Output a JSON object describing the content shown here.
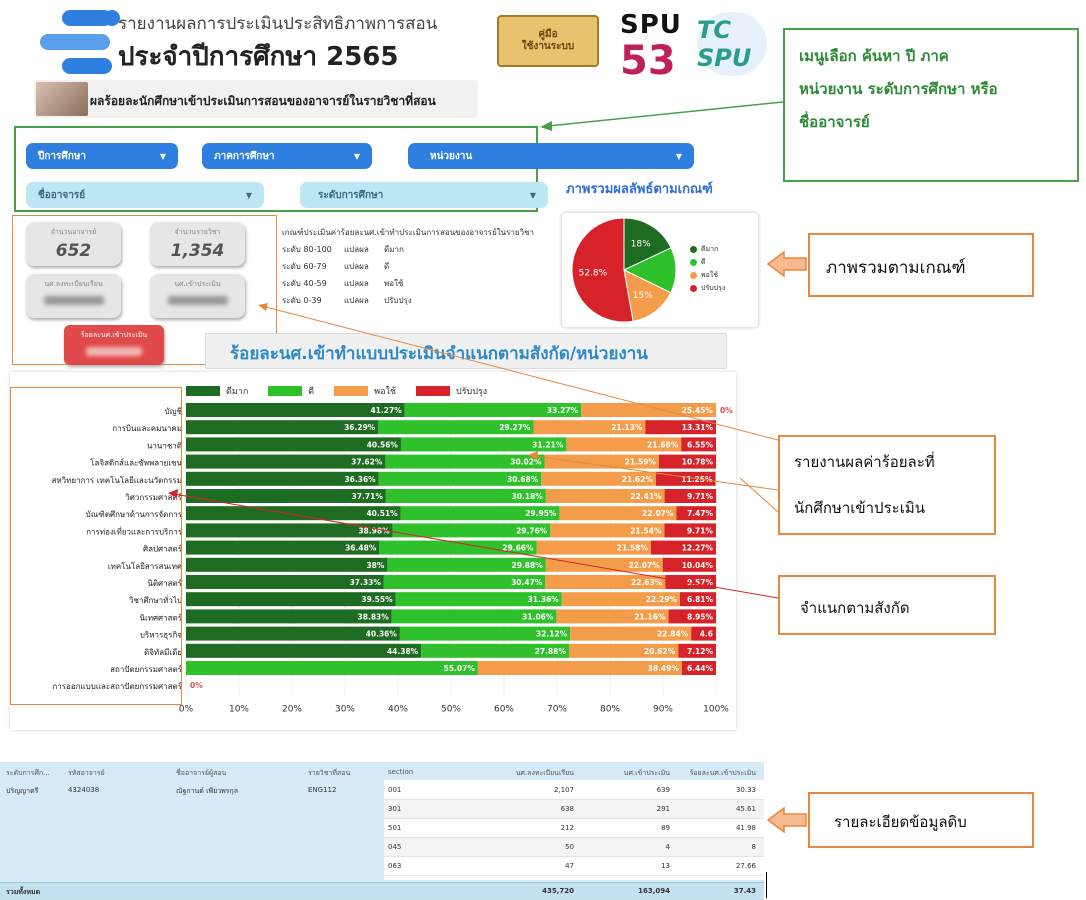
{
  "header": {
    "title_line1": "รายงานผลการประเมินประสิทธิภาพการสอน",
    "title_line2": "ประจำปีการศึกษา 2565",
    "subtitle": "ผลร้อยละนักศึกษาเข้าประเมินการสอนของอาจารย์ในรายวิชาที่สอน",
    "manual_label": "คู่มือ\nใช้งานระบบ",
    "logo_spu": "SPU",
    "logo_53": "53",
    "logo_tcspu": "TC SPU"
  },
  "filters": {
    "year": "ปีการศึกษา",
    "semester": "ภาคการศึกษา",
    "unit": "หน่วยงาน",
    "teacher": "ชื่ออาจารย์",
    "level": "ระดับการศึกษา"
  },
  "annotations": {
    "menu_line1": "เมนูเลือก ค้นหา ปี ภาค",
    "menu_line2": "หน่วยงาน ระดับการศึกษา หรือ",
    "menu_line3": "ชื่ออาจารย์",
    "pie_overview": "ภาพรวมตามเกณฑ์",
    "percent_line1": "รายงานผลค่าร้อยละที่",
    "percent_line2": "นักศึกษาเข้าประเมิน",
    "by_affiliation": "จำแนกตามสังกัด",
    "raw_detail": "รายละเอียดข้อมูลดิบ"
  },
  "cards": {
    "teachers_label": "จำนวนอาจารย์",
    "teachers_value": "652",
    "subjects_label": "จำนวนรายวิชา",
    "subjects_value": "1,354",
    "registered_label": "นศ.ลงทะเบียนเรียน",
    "evaluated_label": "นศ.เข้าประเมิน",
    "percent_label": "ร้อยละนศ.เข้าประเมิน"
  },
  "criteria": {
    "title": "เกณฑ์ประเมินค่าร้อยละนศ.เข้าทำประเมินการสอนของอาจารย์ในรายวิชา",
    "rows": [
      {
        "range": "ระดับ 80-100",
        "mean": "แปลผล",
        "grade": "ดีมาก"
      },
      {
        "range": "ระดับ 60-79",
        "mean": "แปลผล",
        "grade": "ดี"
      },
      {
        "range": "ระดับ 40-59",
        "mean": "แปลผล",
        "grade": "พอใช้"
      },
      {
        "range": "ระดับ 0-39",
        "mean": "แปลผล",
        "grade": "ปรับปรุง"
      }
    ]
  },
  "pie": {
    "title": "ภาพรวมผลลัพธ์ตามเกณฑ์",
    "slices": [
      {
        "name": "ดีมาก",
        "value": 18,
        "label": "18%",
        "color": "#1e6b22"
      },
      {
        "name": "ดี",
        "value": 14.2,
        "label": "",
        "color": "#2fc12c"
      },
      {
        "name": "พอใช้",
        "value": 15,
        "label": "15%",
        "color": "#f39c4a"
      },
      {
        "name": "ปรับปรุง",
        "value": 52.8,
        "label": "52.8%",
        "color": "#d6232a"
      }
    ]
  },
  "bar_title": "ร้อยละนศ.เข้าทำแบบประเมินจำแนกตามสังกัด/หน่วยงาน",
  "chart_data": {
    "type": "bar",
    "orientation": "horizontal-stacked",
    "legend": [
      "ดีมาก",
      "ดี",
      "พอใช้",
      "ปรับปรุง"
    ],
    "colors": [
      "#1e6b22",
      "#2fc12c",
      "#f39c4a",
      "#d6232a"
    ],
    "xlim": [
      0,
      100
    ],
    "xticks": [
      "0%",
      "10%",
      "20%",
      "30%",
      "40%",
      "50%",
      "60%",
      "70%",
      "80%",
      "90%",
      "100%"
    ],
    "categories": [
      "บัญชี",
      "การบินและคมนาคม",
      "นานาชาติ",
      "โลจิสติกส์และซัพพลายเชน",
      "สหวิทยาการ เทคโนโลยีและนวัตกรรม",
      "วิศวกรรมศาสตร์",
      "บัณฑิตศึกษาด้านการจัดการ",
      "การท่องเที่ยวและการบริการ",
      "ศิลปศาสตร์",
      "เทคโนโลยีสารสนเทศ",
      "นิติศาสตร์",
      "วิชาศึกษาทั่วไป",
      "นิเทศศาสตร์",
      "บริหารธุรกิจ",
      "ดิจิทัลมีเดีย",
      "สถาปัตยกรรมศาสตร์",
      "การออกแบบและสถาปัตยกรรมศาสตร์"
    ],
    "series": [
      {
        "name": "ดีมาก",
        "values": [
          41.27,
          36.29,
          40.56,
          37.62,
          36.36,
          37.71,
          40.51,
          38.98,
          36.48,
          38,
          37.33,
          39.55,
          38.83,
          40.36,
          44.38,
          0,
          0
        ]
      },
      {
        "name": "ดี",
        "values": [
          33.27,
          29.27,
          31.21,
          30.02,
          30.68,
          30.18,
          29.95,
          29.76,
          29.66,
          29.88,
          30.47,
          31.36,
          31.06,
          32.12,
          27.88,
          55.07,
          0
        ]
      },
      {
        "name": "พอใช้",
        "values": [
          25.45,
          21.13,
          21.68,
          21.59,
          21.62,
          22.41,
          22.07,
          21.54,
          21.58,
          22.07,
          22.63,
          22.29,
          21.16,
          22.84,
          20.62,
          38.49,
          0
        ]
      },
      {
        "name": "ปรับปรุง",
        "values": [
          0,
          13.31,
          6.55,
          10.78,
          11.25,
          9.71,
          7.47,
          9.71,
          12.27,
          10.04,
          9.57,
          6.81,
          8.95,
          4.68,
          7.12,
          6.44,
          0
        ]
      }
    ],
    "labels": {
      "dimak": [
        "41.27%",
        "36.29%",
        "40.56%",
        "37.62%",
        "36.36%",
        "37.71%",
        "40.51%",
        "38.98%",
        "36.48%",
        "38%",
        "37.33%",
        "39.55%",
        "38.83%",
        "40.36%",
        "44.38%",
        "",
        ""
      ],
      "di": [
        "33.27%",
        "29.27%",
        "31.21%",
        "30.02%",
        "30.68%",
        "30.18%",
        "29.95%",
        "29.76%",
        "29.66%",
        "29.88%",
        "30.47%",
        "31.36%",
        "31.06%",
        "32.12%",
        "27.88%",
        "55.07%",
        ""
      ],
      "porchai": [
        "25.45%",
        "21.13%",
        "21.68%",
        "21.59%",
        "21.62%",
        "22.41%",
        "22.07%",
        "21.54%",
        "21.58%",
        "22.07%",
        "22.63%",
        "22.29%",
        "21.16%",
        "22.84%",
        "20.62%",
        "38.49%",
        ""
      ],
      "prap": [
        "0%",
        "13.31%",
        "6.55%",
        "10.78%",
        "11.25%",
        "9.71%",
        "7.47%",
        "9.71%",
        "12.27%",
        "10.04%",
        "9.57%",
        "6.81%",
        "8.95%",
        "4.6",
        "7.12%",
        "6.44%",
        "0%"
      ]
    }
  },
  "table": {
    "headers": [
      "ระดับการศึก...",
      "รหัสอาจารย์",
      "ชื่ออาจารย์ผู้สอน",
      "รายวิชาที่สอน",
      "section",
      "นศ.ลงทะเบียนเรียน",
      "นศ.เข้าประเมิน",
      "ร้อยละนศ.เข้าประเมิน"
    ],
    "first": {
      "level": "ปริญญาตรี",
      "code": "4324038",
      "name": "ณัฐกานต์ เพียวพรกุล",
      "subject": "ENG112"
    },
    "rows": [
      {
        "section": "001",
        "reg": "2,107",
        "eval": "639",
        "pct": "30.33"
      },
      {
        "section": "301",
        "reg": "638",
        "eval": "291",
        "pct": "45.61"
      },
      {
        "section": "501",
        "reg": "212",
        "eval": "89",
        "pct": "41.98"
      },
      {
        "section": "045",
        "reg": "50",
        "eval": "4",
        "pct": "8"
      },
      {
        "section": "063",
        "reg": "47",
        "eval": "13",
        "pct": "27.66"
      }
    ],
    "total": {
      "label": "รวมทั้งหมด",
      "reg": "435,720",
      "eval": "163,094",
      "pct": "37.43"
    }
  }
}
